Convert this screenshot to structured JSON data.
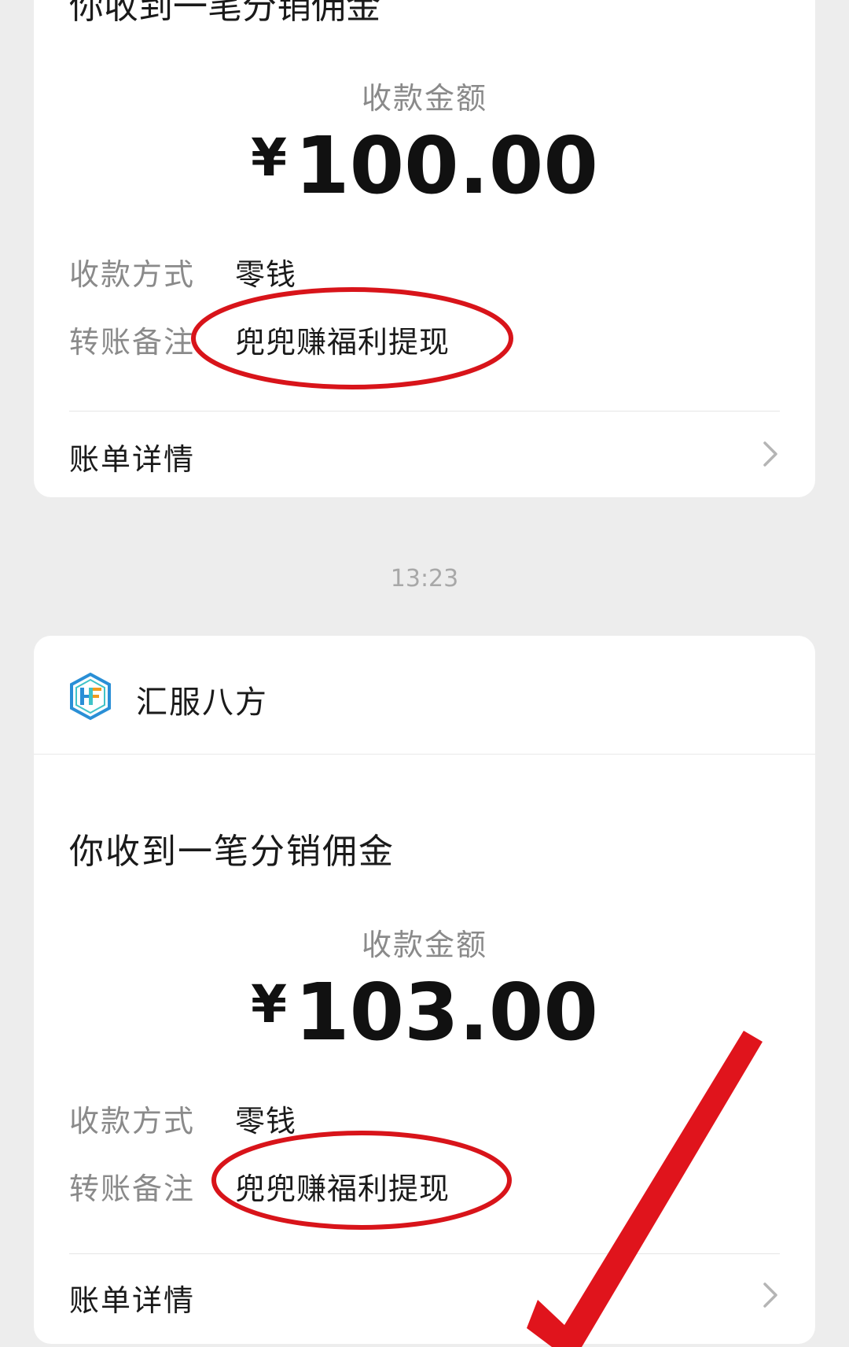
{
  "previous_notice": {
    "clipped_title": "你收到一笔分销佣金",
    "amount_label": "收款金额",
    "currency_symbol": "¥",
    "amount": "100.00",
    "payment_method_label": "收款方式",
    "payment_method_value": "零钱",
    "transfer_note_label": "转账备注",
    "transfer_note_value": "兜兜赚福利提现",
    "bill_details_label": "账单详情"
  },
  "timestamp": "13:23",
  "latest_notice": {
    "merchant_name": "汇服八方",
    "title": "你收到一笔分销佣金",
    "amount_label": "收款金额",
    "currency_symbol": "¥",
    "amount": "103.00",
    "payment_method_label": "收款方式",
    "payment_method_value": "零钱",
    "transfer_note_label": "转账备注",
    "transfer_note_value": "兜兜赚福利提现",
    "bill_details_label": "账单详情"
  },
  "icons": {
    "merchant_logo": "hf-hexagon-logo",
    "chevron": "chevron-right-icon",
    "check_mark": "red-check-mark"
  },
  "colors": {
    "background": "#ededed",
    "card": "#ffffff",
    "annotation_red": "#d8141a",
    "logo_blue": "#2a8fd6",
    "logo_teal": "#3fc3c8",
    "logo_orange": "#f39a1e"
  }
}
